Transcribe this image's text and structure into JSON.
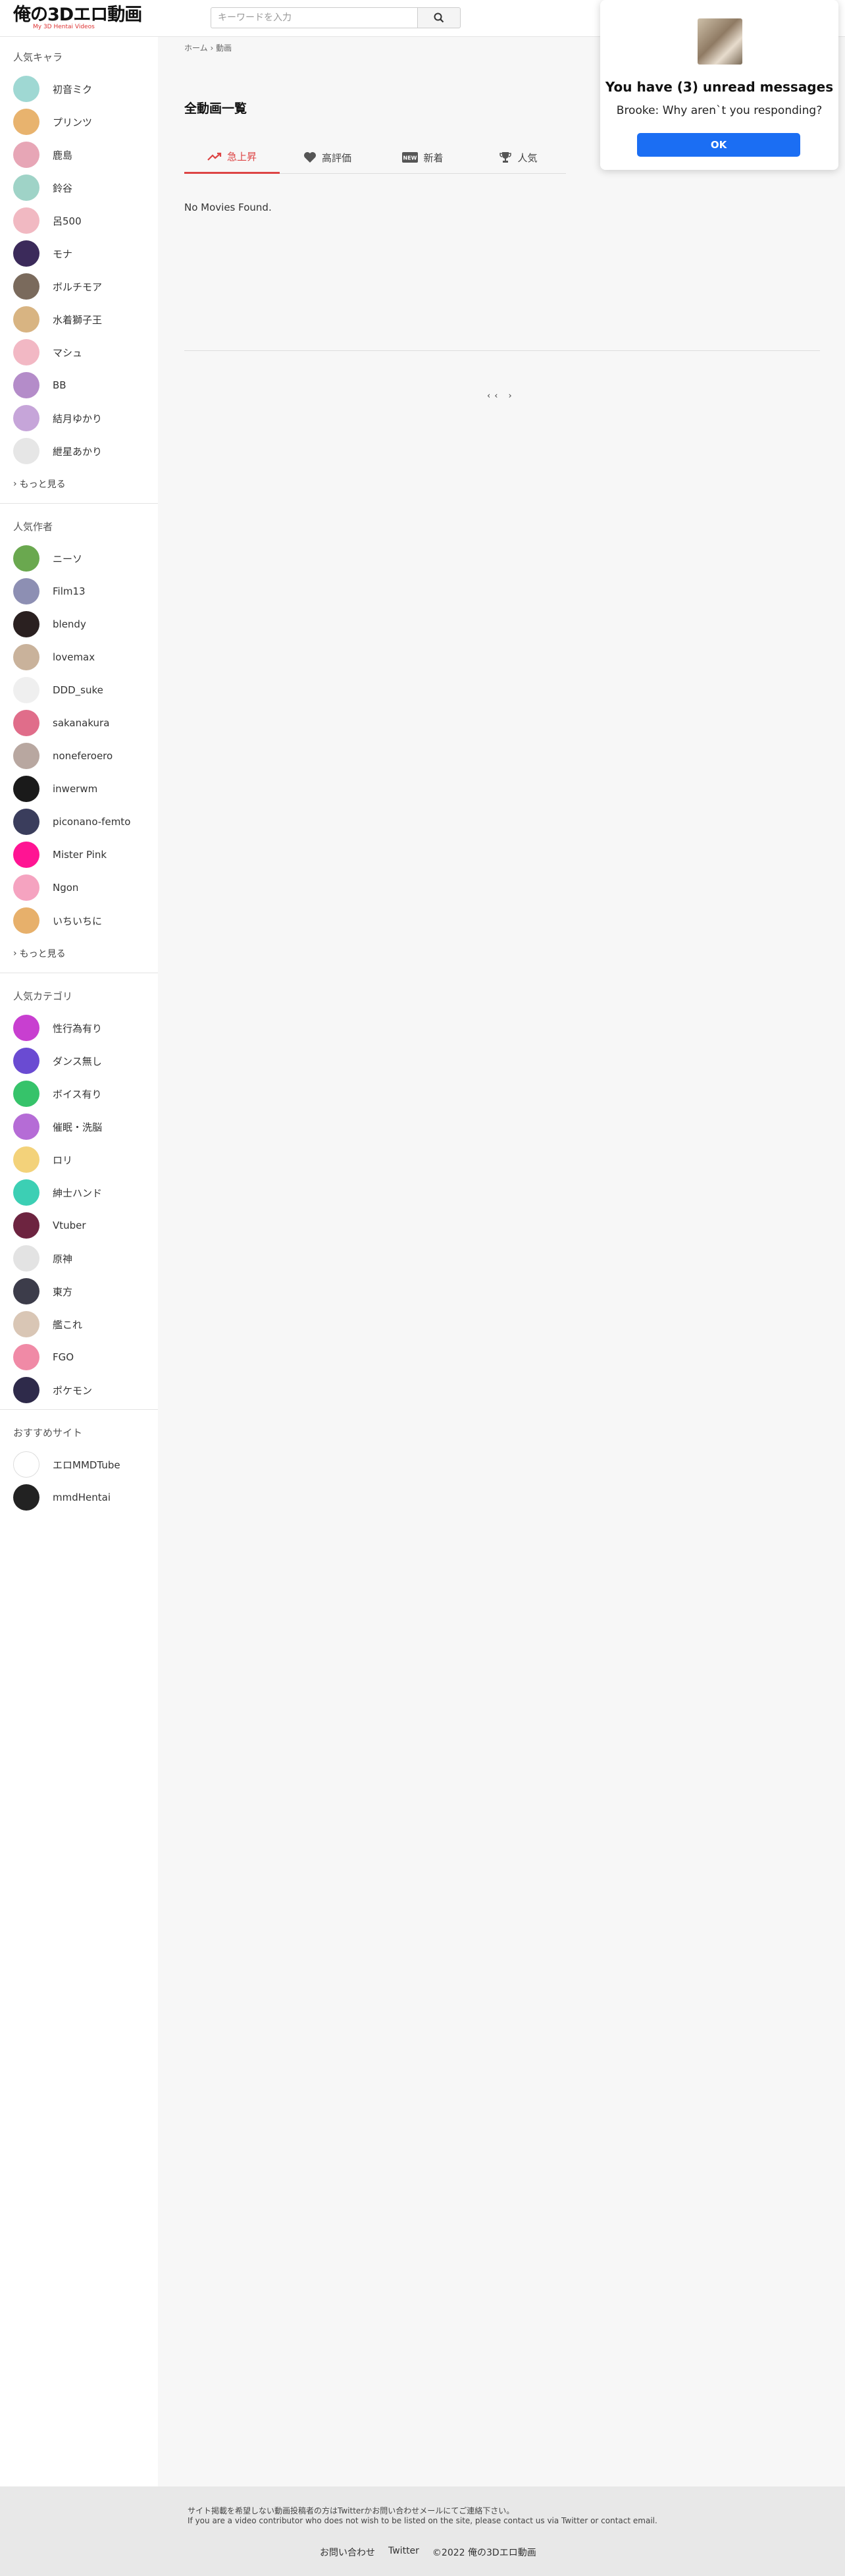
{
  "header": {
    "logo_text": "俺の3Dエロ動画",
    "logo_sub": "My 3D Hentai Videos",
    "search_placeholder": "キーワードを入力"
  },
  "sidebar": {
    "characters_title": "人気キャラ",
    "characters": [
      {
        "label": "初音ミク",
        "color": "#9fd8d3"
      },
      {
        "label": "プリンツ",
        "color": "#e8b36e"
      },
      {
        "label": "鹿島",
        "color": "#e7a6b6"
      },
      {
        "label": "鈴谷",
        "color": "#9fd3c7"
      },
      {
        "label": "呂500",
        "color": "#f1b9c2"
      },
      {
        "label": "モナ",
        "color": "#3b2a5a"
      },
      {
        "label": "ボルチモア",
        "color": "#7a6a5c"
      },
      {
        "label": "水着獅子王",
        "color": "#d8b482"
      },
      {
        "label": "マシュ",
        "color": "#f2b8c4"
      },
      {
        "label": "BB",
        "color": "#b48cc9"
      },
      {
        "label": "結月ゆかり",
        "color": "#c6a5d9"
      },
      {
        "label": "紲星あかり",
        "color": "#e6e6e6"
      }
    ],
    "characters_more": "もっと見る",
    "authors_title": "人気作者",
    "authors": [
      {
        "label": "ニーソ",
        "color": "#6aa84f"
      },
      {
        "label": "Film13",
        "color": "#8d8fb3"
      },
      {
        "label": "blendy",
        "color": "#2a2020"
      },
      {
        "label": "lovemax",
        "color": "#c9b29b"
      },
      {
        "label": "DDD_suke",
        "color": "#efefef"
      },
      {
        "label": "sakanakura",
        "color": "#e06d8a"
      },
      {
        "label": "noneferoero",
        "color": "#b8a7a0"
      },
      {
        "label": "inwerwm",
        "color": "#1a1a1a"
      },
      {
        "label": "piconano-femto",
        "color": "#3a3d5c"
      },
      {
        "label": "Mister Pink",
        "color": "#ff1493"
      },
      {
        "label": "Ngon",
        "color": "#f5a3c0"
      },
      {
        "label": "いちいちに",
        "color": "#e7b06b"
      }
    ],
    "authors_more": "もっと見る",
    "categories_title": "人気カテゴリ",
    "categories": [
      {
        "label": "性行為有り",
        "color": "#c83fd0"
      },
      {
        "label": "ダンス無し",
        "color": "#6a4bd2"
      },
      {
        "label": "ボイス有り",
        "color": "#36c36a"
      },
      {
        "label": "催眠・洗脳",
        "color": "#b56cd6"
      },
      {
        "label": "ロリ",
        "color": "#f3d27a"
      },
      {
        "label": "紳士ハンド",
        "color": "#3ccfb4"
      },
      {
        "label": "Vtuber",
        "color": "#6d2440"
      },
      {
        "label": "原神",
        "color": "#e3e3e3"
      },
      {
        "label": "東方",
        "color": "#3c3c4a"
      },
      {
        "label": "艦これ",
        "color": "#d9c6b5"
      },
      {
        "label": "FGO",
        "color": "#f08aa6"
      },
      {
        "label": "ポケモン",
        "color": "#2e2a4a"
      }
    ],
    "sites_title": "おすすめサイト",
    "sites": [
      {
        "label": "エロMMDTube",
        "color": "#ffffff"
      },
      {
        "label": "mmdHentai",
        "color": "#222222"
      }
    ]
  },
  "main": {
    "breadcrumb": "ホーム › 動画",
    "title": "全動画一覧",
    "tabs": [
      {
        "label": "急上昇",
        "icon": "trending-icon",
        "active": true
      },
      {
        "label": "高評価",
        "icon": "heart-icon",
        "active": false
      },
      {
        "label": "新着",
        "icon": "new-icon",
        "active": false
      },
      {
        "label": "人気",
        "icon": "trophy-icon",
        "active": false
      }
    ],
    "empty_message": "No Movies Found.",
    "pagination": "‹‹ ›"
  },
  "footer": {
    "note_jp": "サイト掲載を希望しない動画投稿者の方はTwitterかお問い合わせメールにてご連絡下さい。",
    "note_en": "If you are a video contributor who does not wish to be listed on the site, please contact us via Twitter or contact email.",
    "contact": "お問い合わせ",
    "twitter": "Twitter",
    "copyright": "©2022 俺の3Dエロ動画"
  },
  "popup": {
    "title": "You have (3) unread messages",
    "message": "Brooke: Why aren`t you responding?",
    "ok_label": "OK",
    "accent": "#1b6ef3"
  },
  "colors": {
    "accent_red": "#dd4444"
  }
}
